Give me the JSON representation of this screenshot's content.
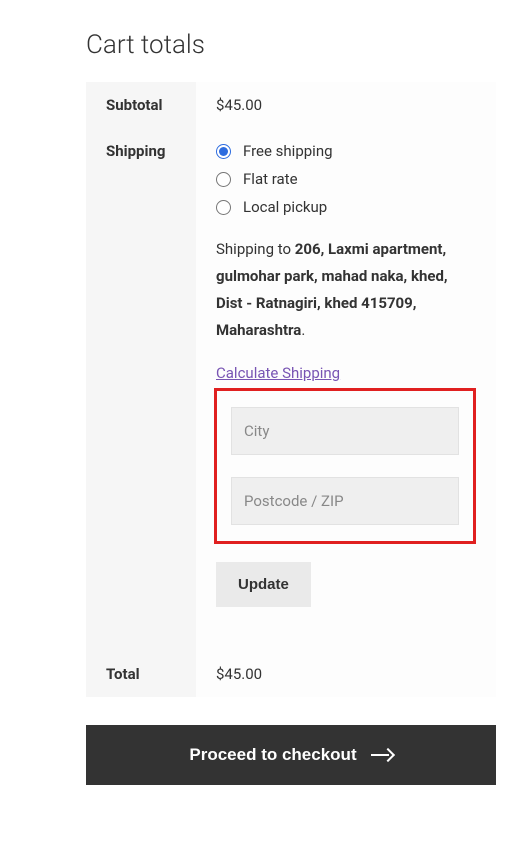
{
  "title": "Cart totals",
  "rows": {
    "subtotal_label": "Subtotal",
    "subtotal_value": "$45.00",
    "shipping_label": "Shipping",
    "total_label": "Total",
    "total_value": "$45.00"
  },
  "shipping": {
    "options": {
      "free": "Free shipping",
      "flat": "Flat rate",
      "local": "Local pickup"
    },
    "selected": "free",
    "destination_prefix": "Shipping to ",
    "destination_address": "206, Laxmi apartment, gulmohar park, mahad naka, khed, Dist - Ratnagiri, khed 415709, Maharashtra",
    "calc_link": "Calculate Shipping",
    "city_placeholder": "City",
    "zip_placeholder": "Postcode / ZIP",
    "update_button": "Update"
  },
  "checkout_button": "Proceed to checkout"
}
